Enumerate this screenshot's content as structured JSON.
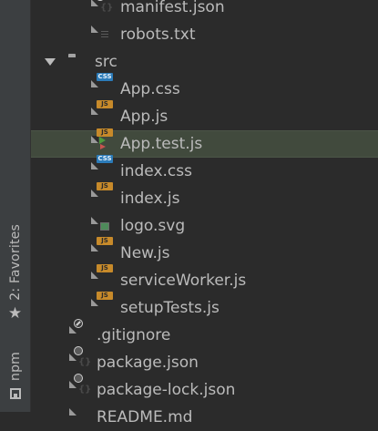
{
  "sidebar": {
    "favorites_label": "2: Favorites",
    "npm_label": "npm"
  },
  "tree": {
    "items": [
      {
        "label": "manifest.json",
        "icon": "json-file-icon"
      },
      {
        "label": "robots.txt",
        "icon": "text-file-icon"
      },
      {
        "label": "src",
        "icon": "folder-icon",
        "expanded": true
      },
      {
        "label": "App.css",
        "icon": "css-file-icon"
      },
      {
        "label": "App.js",
        "icon": "js-file-icon"
      },
      {
        "label": "App.test.js",
        "icon": "test-js-file-icon",
        "selected": true
      },
      {
        "label": "index.css",
        "icon": "css-file-icon"
      },
      {
        "label": "index.js",
        "icon": "js-file-icon"
      },
      {
        "label": "logo.svg",
        "icon": "image-file-icon"
      },
      {
        "label": "New.js",
        "icon": "js-file-icon"
      },
      {
        "label": "serviceWorker.js",
        "icon": "js-file-icon"
      },
      {
        "label": "setupTests.js",
        "icon": "js-file-icon"
      },
      {
        "label": ".gitignore",
        "icon": "ignore-file-icon"
      },
      {
        "label": "package.json",
        "icon": "json-file-icon"
      },
      {
        "label": "package-lock.json",
        "icon": "json-file-icon"
      },
      {
        "label": "README.md",
        "icon": "markdown-file-icon"
      }
    ]
  },
  "badges": {
    "css": "CSS",
    "js": "JS"
  },
  "colors": {
    "background": "#2b2b2b",
    "text": "#bbbbbb",
    "selection": "#414a3d",
    "css_badge": "#2b7bb9",
    "js_badge": "#c78a2a"
  }
}
